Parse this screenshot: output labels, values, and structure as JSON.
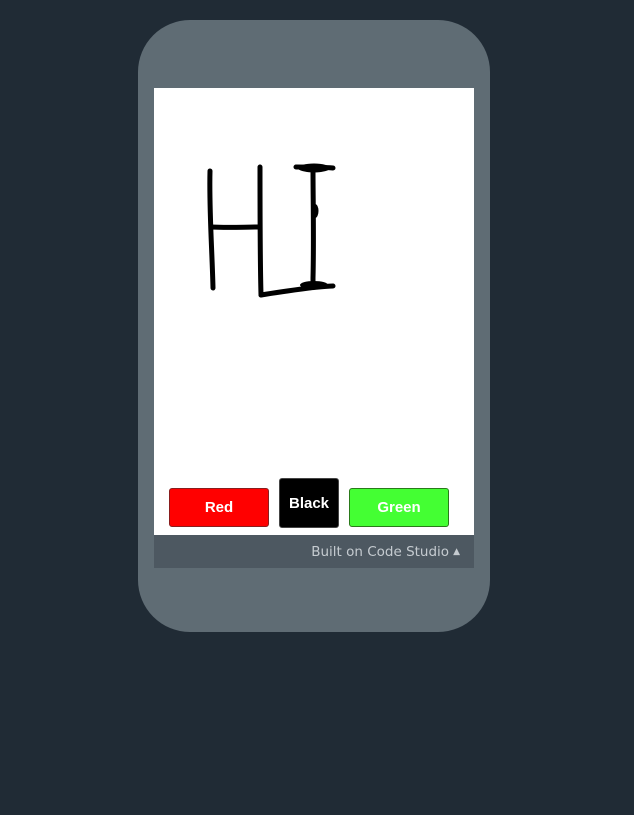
{
  "app": {
    "screen_bg": "#ffffff",
    "page_bg": "#202b35",
    "phone_color": "#5f6c74"
  },
  "buttons": {
    "red": {
      "label": "Red",
      "color": "#ff0000"
    },
    "black": {
      "label": "Black",
      "color": "#000000"
    },
    "green": {
      "label": "Green",
      "color": "#44ff33"
    }
  },
  "footer": {
    "label": "Built on Code Studio",
    "icon": "caret-up-icon"
  }
}
